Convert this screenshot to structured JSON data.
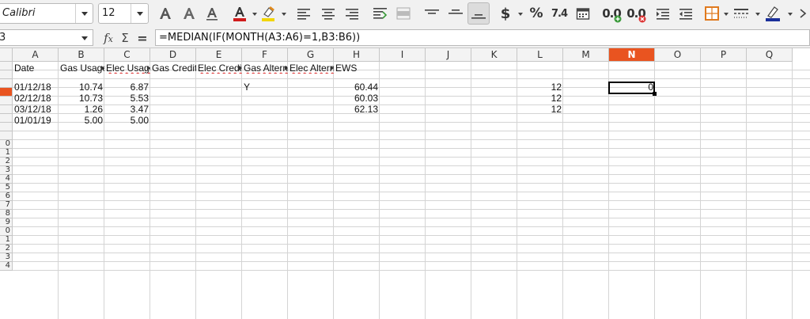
{
  "toolbar": {
    "font_name": "Calibri",
    "font_size": "12",
    "percent_label": "%",
    "number_label": "7.4",
    "dec_add_label": "0.0",
    "dec_del_label": "0.0"
  },
  "formula_bar": {
    "name_box": "3",
    "formula": "=MEDIAN(IF(MONTH(A3:A6)=1,B3:B6))",
    "fx": "f",
    "fx_sub": "x",
    "sum": "Σ",
    "equals": "="
  },
  "grid": {
    "columns": [
      "A",
      "B",
      "C",
      "D",
      "E",
      "F",
      "G",
      "H",
      "I",
      "J",
      "K",
      "L",
      "M",
      "N",
      "O",
      "P",
      "Q"
    ],
    "selected_column": "N",
    "rows": [
      "",
      "",
      "",
      "",
      "",
      "",
      "",
      "",
      "",
      "0",
      "1",
      "2",
      "3",
      "4",
      "5",
      "6",
      "7",
      "8",
      "9",
      "0",
      "1",
      "2",
      "3",
      "4"
    ],
    "selected_row_index": 3,
    "headers": [
      "Date",
      "Gas Usage",
      "Elec Usage",
      "Gas Credit",
      "Elec Credit",
      "Gas Altern",
      "Elec Altern",
      "EWS"
    ],
    "data": [
      {
        "date": "01/12/18",
        "gas": "10.74",
        "elec": "6.87",
        "f": "Y",
        "h": "60.44",
        "l": "12",
        "n": "0"
      },
      {
        "date": "02/12/18",
        "gas": "10.73",
        "elec": "5.53",
        "f": "",
        "h": "60.03",
        "l": "12",
        "n": ""
      },
      {
        "date": "03/12/18",
        "gas": "1.26",
        "elec": "3.47",
        "f": "",
        "h": "62.13",
        "l": "12",
        "n": ""
      },
      {
        "date": "01/01/19",
        "gas": "5.00",
        "elec": "5.00",
        "f": "",
        "h": "",
        "l": "",
        "n": ""
      }
    ]
  },
  "colors": {
    "accent": "#e95420",
    "font_color_bar": "#d01c1c",
    "highlight_bar": "#f2d600"
  }
}
